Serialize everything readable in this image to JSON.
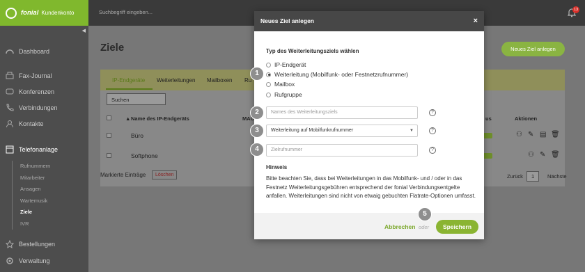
{
  "app": {
    "logo": "fonial",
    "subtitle": "Kundenkonto"
  },
  "search": {
    "placeholder": "Suchbegriff eingeben..."
  },
  "notifications": {
    "count": "13"
  },
  "sidebar": {
    "items": [
      {
        "label": "Dashboard",
        "icon": "dashboard-icon"
      },
      {
        "label": "Fax-Journal",
        "icon": "fax-icon"
      },
      {
        "label": "Konferenzen",
        "icon": "conference-icon"
      },
      {
        "label": "Verbindungen",
        "icon": "phone-icon"
      },
      {
        "label": "Kontakte",
        "icon": "contacts-icon"
      },
      {
        "label": "Telefonanlage",
        "icon": "pbx-icon"
      },
      {
        "label": "Bestellungen",
        "icon": "orders-icon"
      },
      {
        "label": "Verwaltung",
        "icon": "admin-icon"
      }
    ],
    "subitems": [
      "Rufnummern",
      "Mitarbeiter",
      "Ansagen",
      "Wartemusik",
      "Ziele",
      "IVR"
    ]
  },
  "page": {
    "title": "Ziele",
    "new_button": "Neues Ziel anlegen"
  },
  "tabs": [
    "IP-Endgeräte",
    "Weiterleitungen",
    "Mailboxen",
    "Ru"
  ],
  "table": {
    "search_placeholder": "Suchen",
    "col_name": "Name des IP-Endgeräts",
    "col_mac": "MAC",
    "col_status": "us",
    "col_actions": "Aktionen",
    "rows": [
      "Büro",
      "Softphone"
    ],
    "marked": "Markierte Einträge",
    "delete": "Löschen",
    "back": "Zurück",
    "page": "1",
    "next": "Nächste"
  },
  "modal": {
    "title": "Neues Ziel anlegen",
    "close": "×",
    "type_label": "Typ des Weiterleitungsziels wählen",
    "options": [
      "IP-Endgerät",
      "Weiterleitung (Mobilfunk- oder Festnetzrufnummer)",
      "Mailbox",
      "Rufgruppe"
    ],
    "selected_index": 1,
    "name_placeholder": "Names des Weiterleitungsziels",
    "select_value": "Weiterleitung auf Mobilfunkrufnummer",
    "number_placeholder": "Zielrufnummer",
    "help": "?",
    "hint_title": "Hinweis",
    "hint_text": "Bitte beachten Sie, dass bei Weiterleitungen in das Mobilfunk- und / oder in das Festnetz Weiterleitungsgebühren entsprechend der fonial Verbindungsentgelte anfallen. Weiterleitungen sind nicht von etwaig gebuchten Flatrate-Optionen umfasst.",
    "cancel": "Abbrechen",
    "or": "oder",
    "save": "Speichern"
  },
  "steps": [
    "1",
    "2",
    "3",
    "4",
    "5"
  ],
  "colors": {
    "accent": "#8ab432",
    "header": "#474747"
  }
}
